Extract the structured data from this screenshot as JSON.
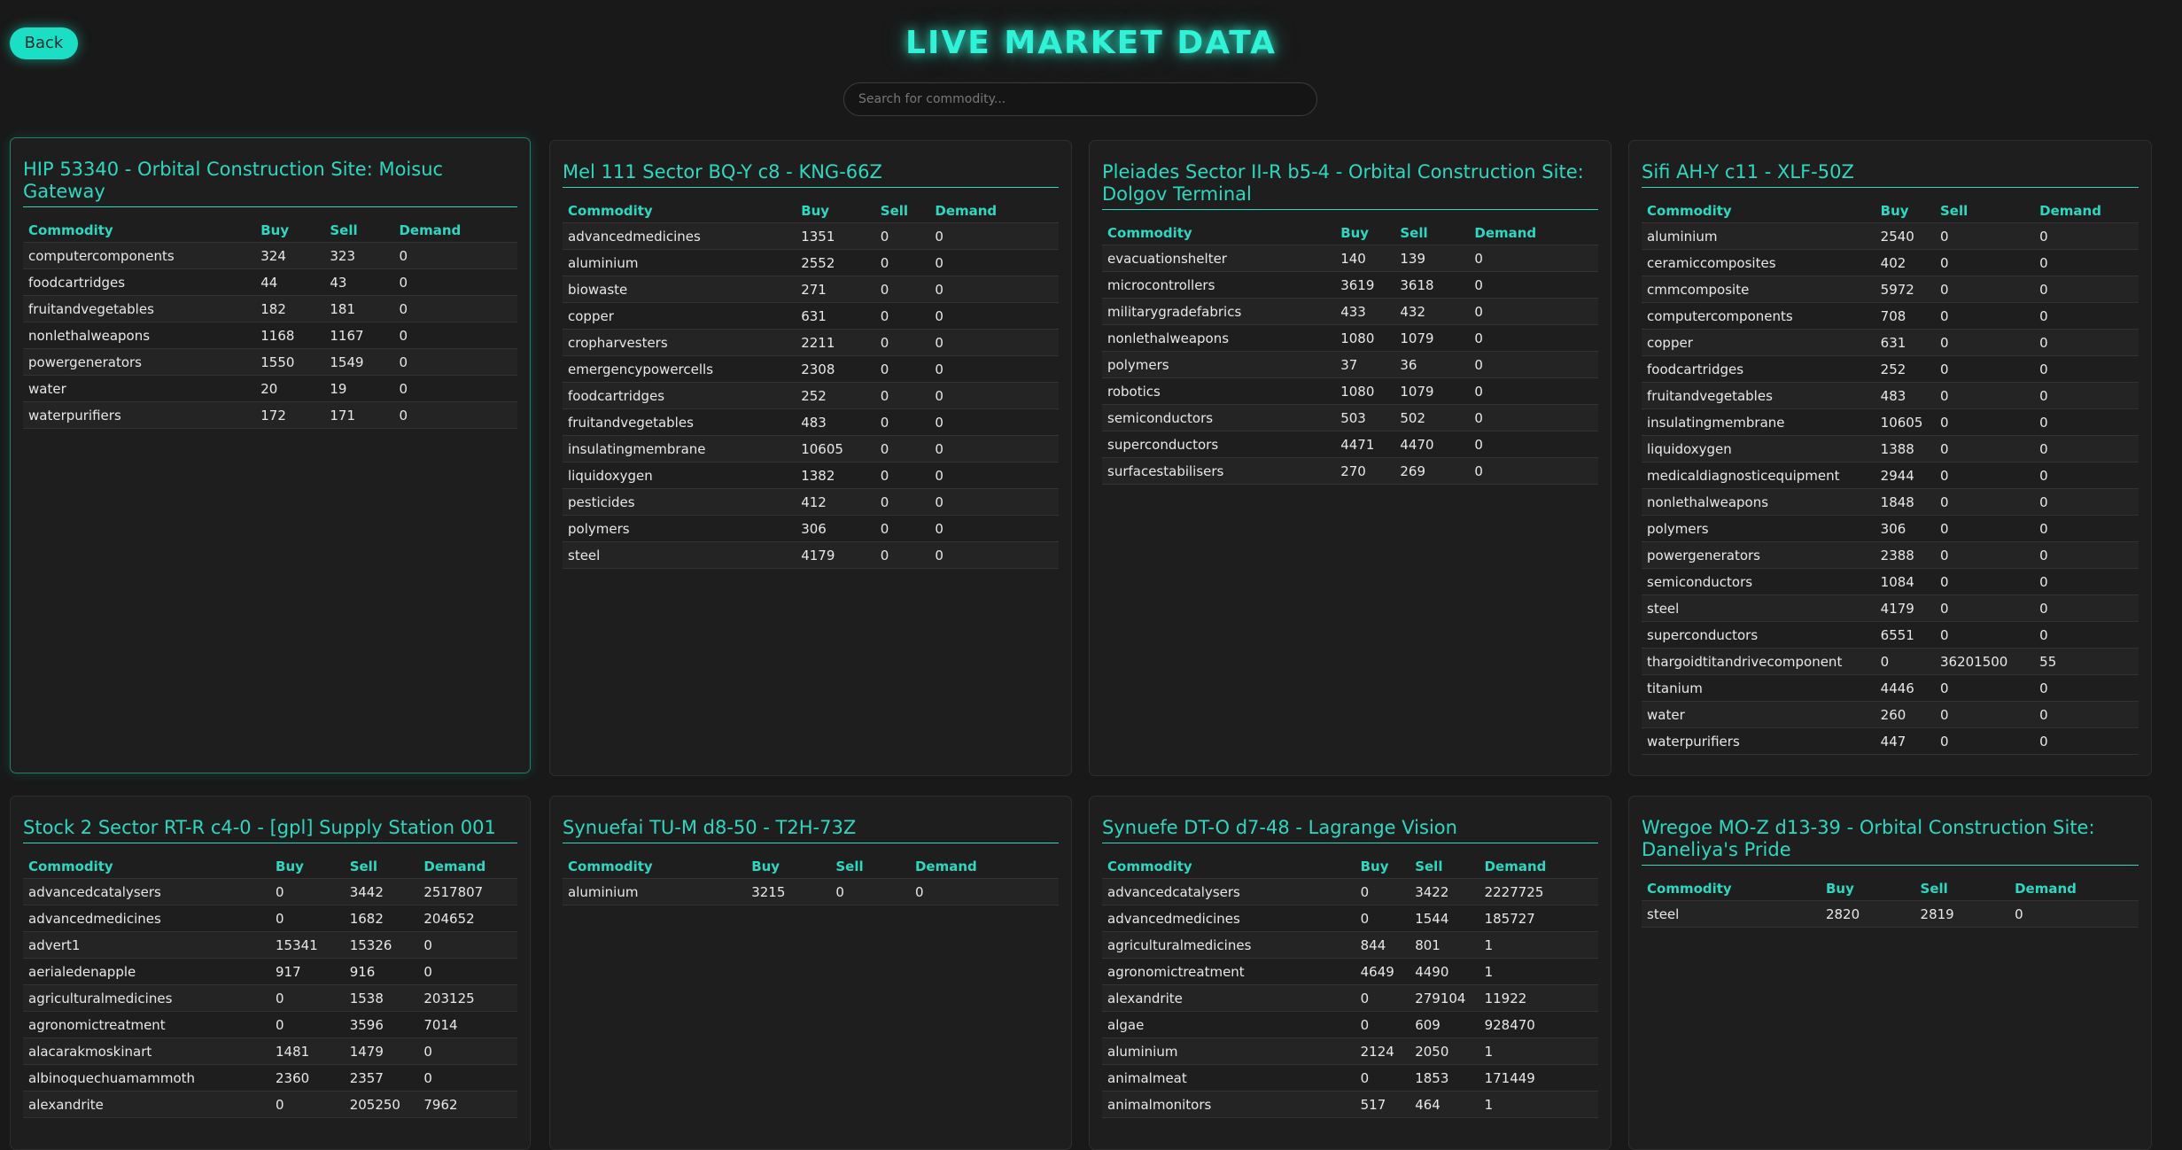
{
  "header": {
    "back_label": "Back",
    "title": "LIVE MARKET DATA",
    "search_placeholder": "Search for commodity..."
  },
  "columns": [
    "Commodity",
    "Buy",
    "Sell",
    "Demand"
  ],
  "stations": [
    {
      "name": "HIP 53340 - Orbital Construction Site: Moisuc Gateway",
      "rows": [
        [
          "computercomponents",
          "324",
          "323",
          "0"
        ],
        [
          "foodcartridges",
          "44",
          "43",
          "0"
        ],
        [
          "fruitandvegetables",
          "182",
          "181",
          "0"
        ],
        [
          "nonlethalweapons",
          "1168",
          "1167",
          "0"
        ],
        [
          "powergenerators",
          "1550",
          "1549",
          "0"
        ],
        [
          "water",
          "20",
          "19",
          "0"
        ],
        [
          "waterpurifiers",
          "172",
          "171",
          "0"
        ]
      ]
    },
    {
      "name": "Mel 111 Sector BQ-Y c8 - KNG-66Z",
      "rows": [
        [
          "advancedmedicines",
          "1351",
          "0",
          "0"
        ],
        [
          "aluminium",
          "2552",
          "0",
          "0"
        ],
        [
          "biowaste",
          "271",
          "0",
          "0"
        ],
        [
          "copper",
          "631",
          "0",
          "0"
        ],
        [
          "cropharvesters",
          "2211",
          "0",
          "0"
        ],
        [
          "emergencypowercells",
          "2308",
          "0",
          "0"
        ],
        [
          "foodcartridges",
          "252",
          "0",
          "0"
        ],
        [
          "fruitandvegetables",
          "483",
          "0",
          "0"
        ],
        [
          "insulatingmembrane",
          "10605",
          "0",
          "0"
        ],
        [
          "liquidoxygen",
          "1382",
          "0",
          "0"
        ],
        [
          "pesticides",
          "412",
          "0",
          "0"
        ],
        [
          "polymers",
          "306",
          "0",
          "0"
        ],
        [
          "steel",
          "4179",
          "0",
          "0"
        ]
      ]
    },
    {
      "name": "Pleiades Sector II-R b5-4 - Orbital Construction Site: Dolgov Terminal",
      "rows": [
        [
          "evacuationshelter",
          "140",
          "139",
          "0"
        ],
        [
          "microcontrollers",
          "3619",
          "3618",
          "0"
        ],
        [
          "militarygradefabrics",
          "433",
          "432",
          "0"
        ],
        [
          "nonlethalweapons",
          "1080",
          "1079",
          "0"
        ],
        [
          "polymers",
          "37",
          "36",
          "0"
        ],
        [
          "robotics",
          "1080",
          "1079",
          "0"
        ],
        [
          "semiconductors",
          "503",
          "502",
          "0"
        ],
        [
          "superconductors",
          "4471",
          "4470",
          "0"
        ],
        [
          "surfacestabilisers",
          "270",
          "269",
          "0"
        ]
      ]
    },
    {
      "name": "Sifi AH-Y c11 - XLF-50Z",
      "rows": [
        [
          "aluminium",
          "2540",
          "0",
          "0"
        ],
        [
          "ceramiccomposites",
          "402",
          "0",
          "0"
        ],
        [
          "cmmcomposite",
          "5972",
          "0",
          "0"
        ],
        [
          "computercomponents",
          "708",
          "0",
          "0"
        ],
        [
          "copper",
          "631",
          "0",
          "0"
        ],
        [
          "foodcartridges",
          "252",
          "0",
          "0"
        ],
        [
          "fruitandvegetables",
          "483",
          "0",
          "0"
        ],
        [
          "insulatingmembrane",
          "10605",
          "0",
          "0"
        ],
        [
          "liquidoxygen",
          "1388",
          "0",
          "0"
        ],
        [
          "medicaldiagnosticequipment",
          "2944",
          "0",
          "0"
        ],
        [
          "nonlethalweapons",
          "1848",
          "0",
          "0"
        ],
        [
          "polymers",
          "306",
          "0",
          "0"
        ],
        [
          "powergenerators",
          "2388",
          "0",
          "0"
        ],
        [
          "semiconductors",
          "1084",
          "0",
          "0"
        ],
        [
          "steel",
          "4179",
          "0",
          "0"
        ],
        [
          "superconductors",
          "6551",
          "0",
          "0"
        ],
        [
          "thargoidtitandrivecomponent",
          "0",
          "36201500",
          "55"
        ],
        [
          "titanium",
          "4446",
          "0",
          "0"
        ],
        [
          "water",
          "260",
          "0",
          "0"
        ],
        [
          "waterpurifiers",
          "447",
          "0",
          "0"
        ]
      ]
    },
    {
      "name": "Stock 2 Sector RT-R c4-0 - [gpl] Supply Station 001",
      "rows": [
        [
          "advancedcatalysers",
          "0",
          "3442",
          "2517807"
        ],
        [
          "advancedmedicines",
          "0",
          "1682",
          "204652"
        ],
        [
          "advert1",
          "15341",
          "15326",
          "0"
        ],
        [
          "aerialedenapple",
          "917",
          "916",
          "0"
        ],
        [
          "agriculturalmedicines",
          "0",
          "1538",
          "203125"
        ],
        [
          "agronomictreatment",
          "0",
          "3596",
          "7014"
        ],
        [
          "alacarakmoskinart",
          "1481",
          "1479",
          "0"
        ],
        [
          "albinoquechuamammoth",
          "2360",
          "2357",
          "0"
        ],
        [
          "alexandrite",
          "0",
          "205250",
          "7962"
        ]
      ]
    },
    {
      "name": "Synuefai TU-M d8-50 - T2H-73Z",
      "rows": [
        [
          "aluminium",
          "3215",
          "0",
          "0"
        ]
      ]
    },
    {
      "name": "Synuefe DT-O d7-48 - Lagrange Vision",
      "rows": [
        [
          "advancedcatalysers",
          "0",
          "3422",
          "2227725"
        ],
        [
          "advancedmedicines",
          "0",
          "1544",
          "185727"
        ],
        [
          "agriculturalmedicines",
          "844",
          "801",
          "1"
        ],
        [
          "agronomictreatment",
          "4649",
          "4490",
          "1"
        ],
        [
          "alexandrite",
          "0",
          "279104",
          "11922"
        ],
        [
          "algae",
          "0",
          "609",
          "928470"
        ],
        [
          "aluminium",
          "2124",
          "2050",
          "1"
        ],
        [
          "animalmeat",
          "0",
          "1853",
          "171449"
        ],
        [
          "animalmonitors",
          "517",
          "464",
          "1"
        ]
      ]
    },
    {
      "name": "Wregoe MO-Z d13-39 - Orbital Construction Site: Daneliya's Pride",
      "rows": [
        [
          "steel",
          "2820",
          "2819",
          "0"
        ]
      ]
    }
  ]
}
